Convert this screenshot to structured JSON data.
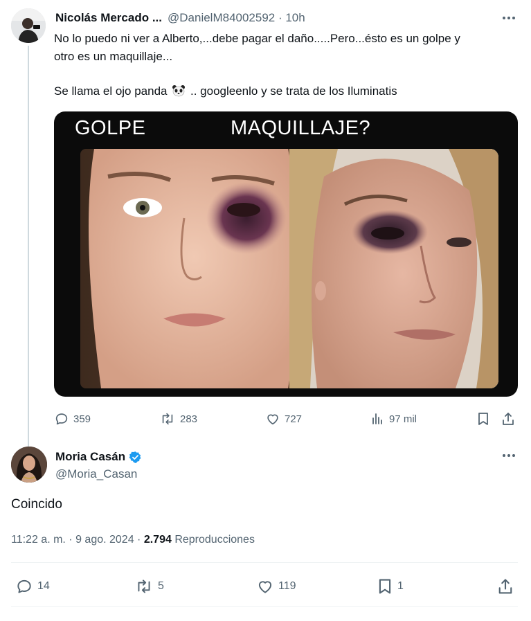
{
  "tweet1": {
    "author_name": "Nicolás Mercado ...",
    "author_handle": "@DanielM84002592 · 10h",
    "text_line1": "No lo puedo ni ver a Alberto,...debe pagar el daño.....Pero...ésto es un golpe y",
    "text_line2": "otro es un maquillaje...",
    "text_line3_a": "Se llama el ojo panda",
    "text_line3_b": ".. googleenlo y se trata de los Iluminatis",
    "media": {
      "label_left": "GOLPE",
      "label_right": "MAQUILLAJE?"
    },
    "actions": {
      "replies": "359",
      "reposts": "283",
      "likes": "727",
      "views": "97 mil"
    }
  },
  "tweet2": {
    "author_name": "Moria Casán",
    "author_handle": "@Moria_Casan",
    "text": "Coincido",
    "time": "11:22 a. m. · 9 ago. 2024 ·",
    "views_count": "2.794",
    "views_label": "Reproducciones",
    "actions": {
      "replies": "14",
      "reposts": "5",
      "likes": "119",
      "bookmarks": "1"
    }
  },
  "icons": {
    "more": "more-options-icon",
    "reply": "reply-icon",
    "repost": "repost-icon",
    "like": "heart-icon",
    "views": "views-chart-icon",
    "bookmark": "bookmark-icon",
    "share": "share-icon",
    "verified": "verified-badge-icon",
    "panda": "panda-emoji-icon"
  },
  "colors": {
    "text": "#0f1419",
    "secondary": "#536471",
    "verified": "#1d9bf0",
    "thread_line": "#cfd9de"
  }
}
